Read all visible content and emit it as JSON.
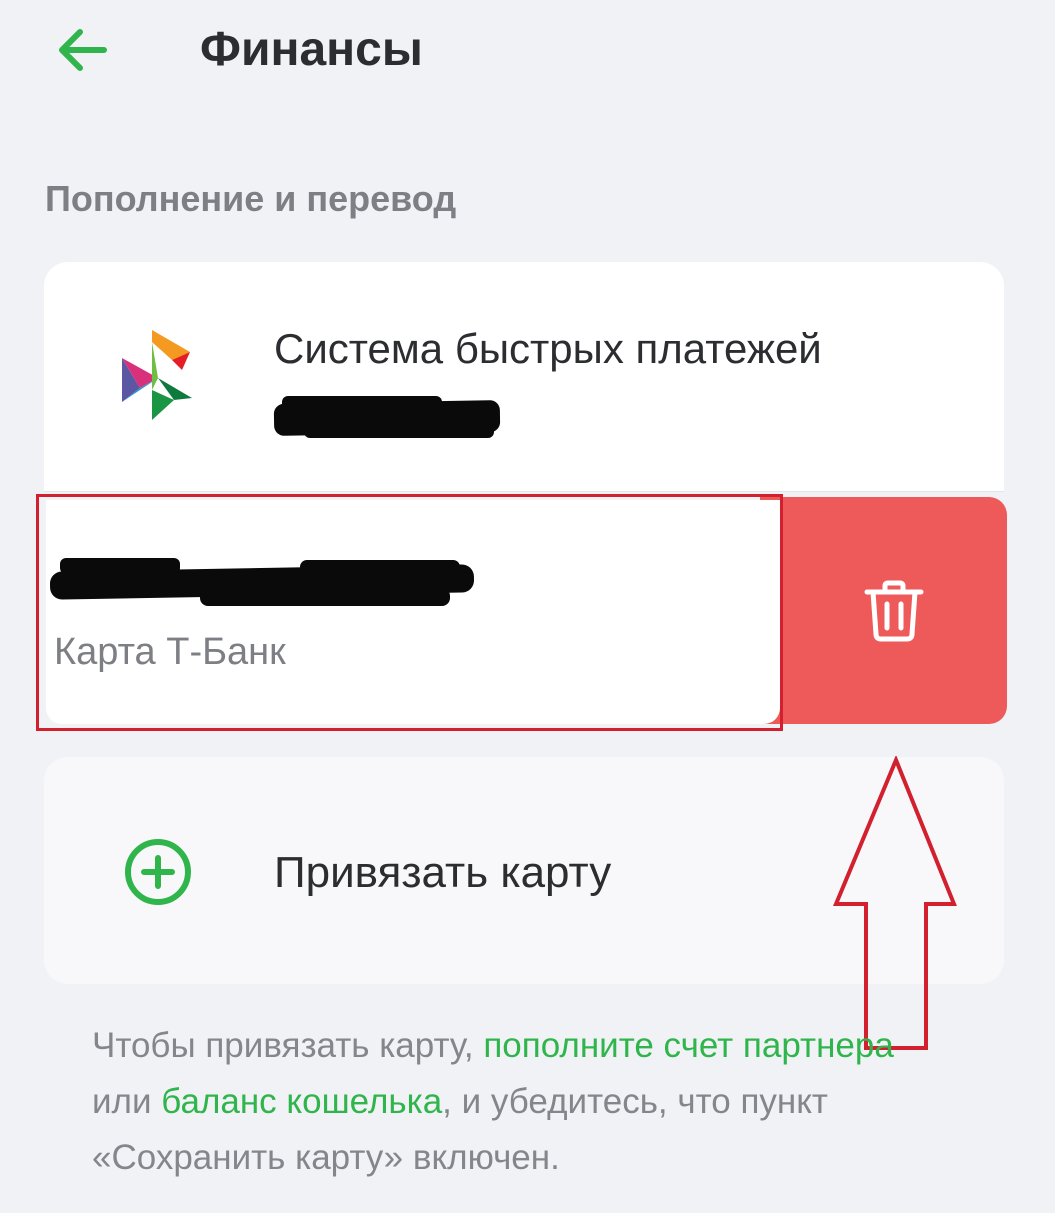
{
  "header": {
    "title": "Финансы",
    "back_icon": "arrow-left-icon",
    "accent_color": "#2fb54b"
  },
  "section": {
    "title": "Пополнение и перевод"
  },
  "sbp": {
    "title": "Система быстрых платежей",
    "subtitle_redacted": true
  },
  "saved_card": {
    "number_redacted": true,
    "label": "Карта Т-Банк",
    "delete_icon": "trash-icon",
    "delete_color": "#ee5a5a"
  },
  "add_card": {
    "label": "Привязать карту",
    "icon": "plus-circle-icon"
  },
  "hint": {
    "part1": "Чтобы привязать карту, ",
    "link1": "пополните счет партнера",
    "part2": " или ",
    "link2": "баланс кошелька",
    "part3": ", и убедитесь, что пункт «Сохранить карту» включен."
  },
  "annotation": {
    "highlight_color": "#d2202e"
  }
}
